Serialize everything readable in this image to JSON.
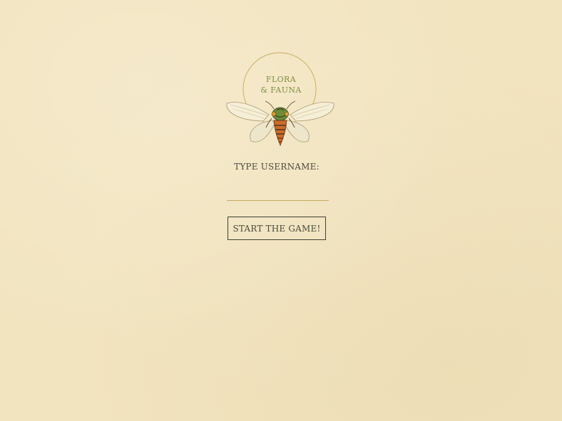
{
  "logo": {
    "line1": "FLORA",
    "line2": "& FAUNA",
    "icon": "cicada-icon"
  },
  "login": {
    "prompt": "TYPE USERNAME:",
    "username_value": "",
    "start_button": "START THE GAME!"
  },
  "colors": {
    "background": "#f2e4bf",
    "logo_text": "#7f8e44",
    "accent_line": "#c7aa5d",
    "button_border": "#3f4033"
  }
}
